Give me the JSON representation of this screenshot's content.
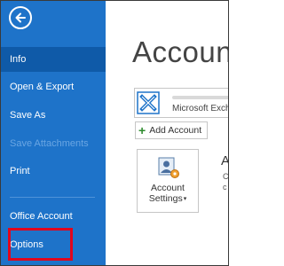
{
  "sidebar": {
    "items": [
      {
        "label": "Info"
      },
      {
        "label": "Open & Export"
      },
      {
        "label": "Save As"
      },
      {
        "label": "Save Attachments"
      },
      {
        "label": "Print"
      },
      {
        "label": "Office Account"
      },
      {
        "label": "Options"
      }
    ]
  },
  "main": {
    "title": "Account",
    "account": {
      "type": "Microsoft Exch"
    },
    "add_account_label": "Add Account",
    "settings": {
      "line1": "Account",
      "line2": "Settings"
    },
    "cut_heading": "A",
    "cut_lines": [
      "C",
      "c"
    ]
  },
  "colors": {
    "sidebar_bg": "#1e73c9",
    "active_bg": "#0f5aa8",
    "highlight": "#e1061d"
  },
  "icons": [
    "back-arrow-icon",
    "exchange-icon",
    "plus-icon",
    "account-settings-icon"
  ]
}
